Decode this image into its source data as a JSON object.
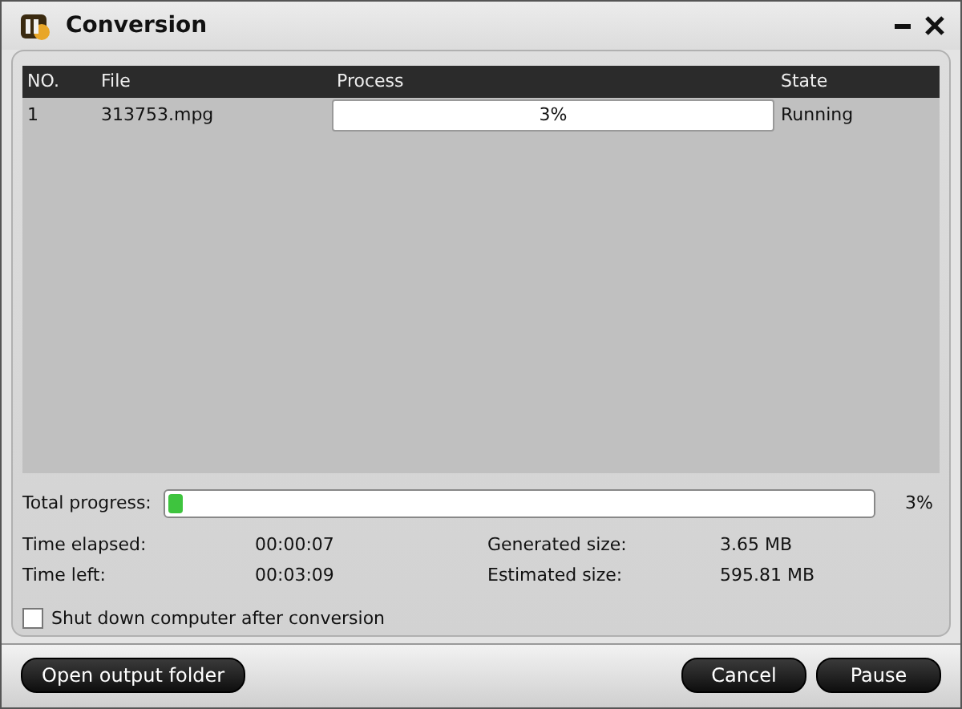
{
  "window": {
    "title": "Conversion"
  },
  "table": {
    "columns": [
      "NO.",
      "File",
      "Process",
      "State"
    ],
    "rows": [
      {
        "no": "1",
        "file": "313753.mpg",
        "process": "3%",
        "state": "Running"
      }
    ]
  },
  "total_progress": {
    "label": "Total progress:",
    "level": 0.02,
    "reading": "3%"
  },
  "stats": [
    {
      "label": "Time elapsed:",
      "value": "00:00:07"
    },
    {
      "label": "Generated size:",
      "value": "3.65 MB"
    },
    {
      "label": "Time left:",
      "value": "00:03:09"
    },
    {
      "label": "Estimated size:",
      "value": "595.81 MB"
    }
  ],
  "shutdown": {
    "label": "Shut down computer after conversion",
    "checked": false
  },
  "buttons_left": [
    "Open output folder"
  ],
  "buttons_right": [
    "Cancel",
    "Pause"
  ]
}
